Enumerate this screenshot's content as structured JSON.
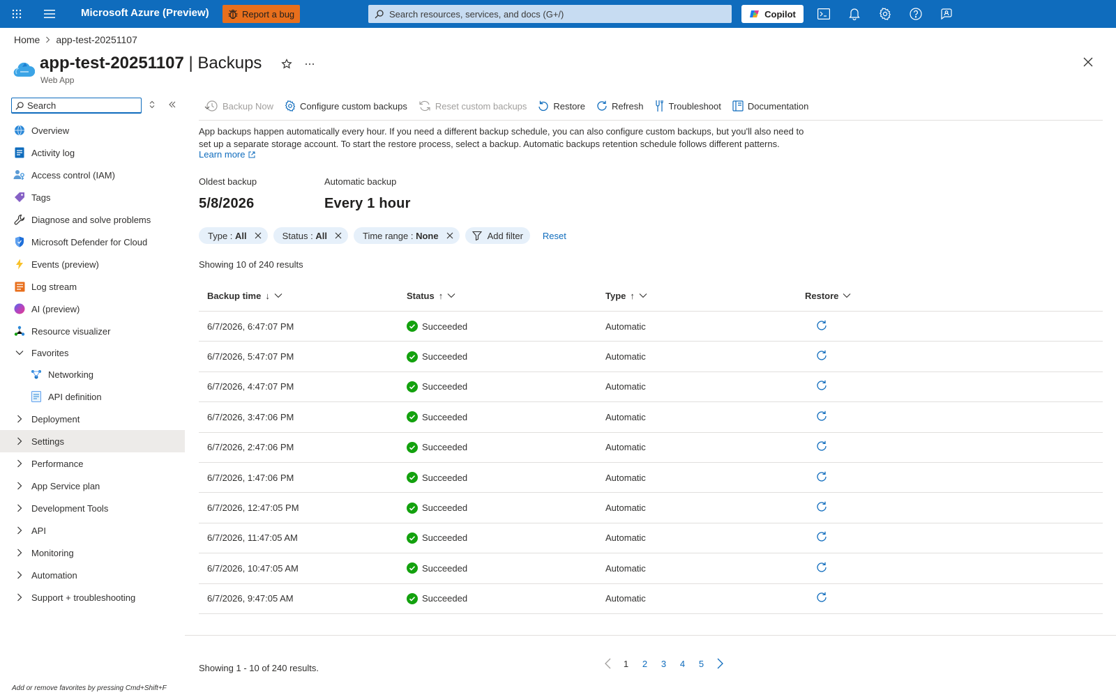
{
  "topbar": {
    "brand": "Microsoft Azure (Preview)",
    "report_bug": "Report a bug",
    "search_placeholder": "Search resources, services, and docs (G+/)",
    "copilot": "Copilot"
  },
  "breadcrumb": {
    "home": "Home",
    "current": "app-test-20251107"
  },
  "title": {
    "resource": "app-test-20251107",
    "separator": " | ",
    "blade": "Backups",
    "subtitle": "Web App"
  },
  "sidebar": {
    "search_placeholder": "Search",
    "items": [
      {
        "label": "Overview",
        "icon": "globe-icon"
      },
      {
        "label": "Activity log",
        "icon": "activity-log-icon"
      },
      {
        "label": "Access control (IAM)",
        "icon": "iam-icon"
      },
      {
        "label": "Tags",
        "icon": "tag-icon"
      },
      {
        "label": "Diagnose and solve problems",
        "icon": "wrench-icon"
      },
      {
        "label": "Microsoft Defender for Cloud",
        "icon": "shield-icon"
      },
      {
        "label": "Events (preview)",
        "icon": "lightning-icon"
      },
      {
        "label": "Log stream",
        "icon": "log-stream-icon"
      },
      {
        "label": "AI (preview)",
        "icon": "ai-icon"
      },
      {
        "label": "Resource visualizer",
        "icon": "visualizer-icon"
      }
    ],
    "favorites": {
      "label": "Favorites",
      "items": [
        {
          "label": "Networking"
        },
        {
          "label": "API definition"
        }
      ]
    },
    "groups": [
      "Deployment",
      "Settings",
      "Performance",
      "App Service plan",
      "Development Tools",
      "API",
      "Monitoring",
      "Automation",
      "Support + troubleshooting"
    ],
    "fav_hint_prefix": "Add or remove favorites by pressing ",
    "fav_hint_keys": "Cmd+Shift+F"
  },
  "commands": {
    "backup_now": "Backup Now",
    "configure": "Configure custom backups",
    "reset_custom": "Reset custom backups",
    "restore": "Restore",
    "refresh": "Refresh",
    "troubleshoot": "Troubleshoot",
    "documentation": "Documentation"
  },
  "content": {
    "description": "App backups happen automatically every hour. If you need a different backup schedule, you can also configure custom backups, but you'll also need to set up a separate storage account. To start the restore process, select a backup. Automatic backups retention schedule follows different patterns.",
    "learn_more": "Learn more",
    "oldest_label": "Oldest backup",
    "oldest_value": "5/8/2026",
    "auto_label": "Automatic backup",
    "auto_value": "Every 1 hour"
  },
  "filters": {
    "type": {
      "key": "Type : ",
      "value": "All"
    },
    "status": {
      "key": "Status : ",
      "value": "All"
    },
    "time": {
      "key": "Time range : ",
      "value": "None"
    },
    "add": "Add filter",
    "reset": "Reset"
  },
  "results_text": "Showing 10 of 240 results",
  "table": {
    "columns": {
      "backup_time": "Backup time",
      "backup_time_sort": "↓",
      "status": "Status",
      "status_sort": "↑",
      "type": "Type",
      "type_sort": "↑",
      "restore": "Restore"
    },
    "rows": [
      {
        "time": "6/7/2026, 6:47:07 PM",
        "status": "Succeeded",
        "type": "Automatic"
      },
      {
        "time": "6/7/2026, 5:47:07 PM",
        "status": "Succeeded",
        "type": "Automatic"
      },
      {
        "time": "6/7/2026, 4:47:07 PM",
        "status": "Succeeded",
        "type": "Automatic"
      },
      {
        "time": "6/7/2026, 3:47:06 PM",
        "status": "Succeeded",
        "type": "Automatic"
      },
      {
        "time": "6/7/2026, 2:47:06 PM",
        "status": "Succeeded",
        "type": "Automatic"
      },
      {
        "time": "6/7/2026, 1:47:06 PM",
        "status": "Succeeded",
        "type": "Automatic"
      },
      {
        "time": "6/7/2026, 12:47:05 PM",
        "status": "Succeeded",
        "type": "Automatic"
      },
      {
        "time": "6/7/2026, 11:47:05 AM",
        "status": "Succeeded",
        "type": "Automatic"
      },
      {
        "time": "6/7/2026, 10:47:05 AM",
        "status": "Succeeded",
        "type": "Automatic"
      },
      {
        "time": "6/7/2026, 9:47:05 AM",
        "status": "Succeeded",
        "type": "Automatic"
      }
    ]
  },
  "pager": {
    "text": "Showing 1 - 10 of 240 results.",
    "pages": [
      "1",
      "2",
      "3",
      "4",
      "5"
    ],
    "current": "1"
  },
  "colors": {
    "topbar": "#0f6cbd",
    "accent": "#0f6cbd",
    "bug": "#e86f1c",
    "success": "#13a10e",
    "selected_nav": "#edebe9",
    "pill": "#e6f0fa"
  }
}
